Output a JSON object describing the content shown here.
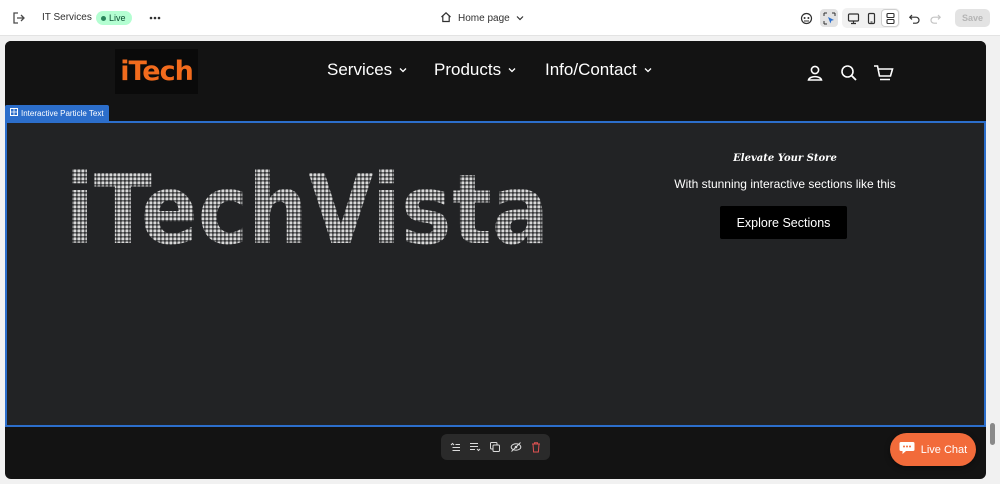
{
  "topbar": {
    "store_name": "IT Services",
    "live_label": "Live",
    "page_label": "Home page",
    "save_label": "Save"
  },
  "site": {
    "logo_text": "iTech",
    "nav": [
      {
        "label": "Services"
      },
      {
        "label": "Products"
      },
      {
        "label": "Info/Contact"
      }
    ]
  },
  "section": {
    "tag_label": "Interactive Particle Text",
    "particle_text": "iTechVista",
    "tagline": "Elevate Your Store",
    "subtext": "With stunning interactive sections like this",
    "cta_label": "Explore Sections"
  },
  "chat": {
    "label": "Live Chat"
  },
  "colors": {
    "accent_orange": "#f26b1d",
    "selection_blue": "#2c6ecb",
    "live_green": "#b4fed2",
    "section_bg": "#222325"
  }
}
